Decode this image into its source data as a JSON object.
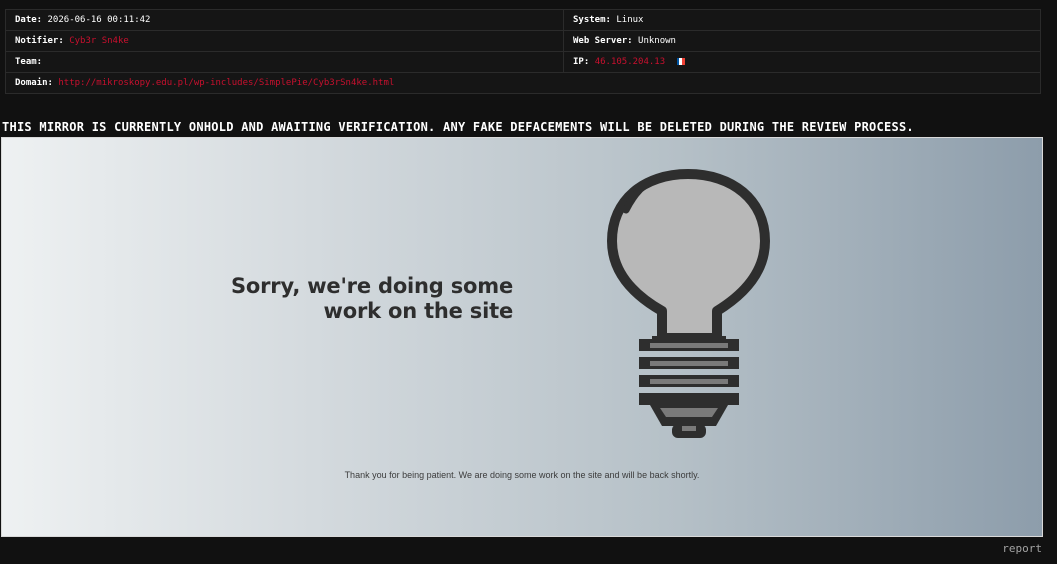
{
  "info": {
    "date_label": "Date:",
    "date_value": "2026-06-16 00:11:42",
    "system_label": "System:",
    "system_value": "Linux",
    "notifier_label": "Notifier:",
    "notifier_value": "Cyb3r Sn4ke",
    "webserver_label": "Web Server:",
    "webserver_value": "Unknown",
    "team_label": "Team:",
    "team_value": "",
    "ip_label": "IP:",
    "ip_value": "46.105.204.13",
    "domain_label": "Domain:",
    "domain_value": "http://mikroskopy.edu.pl/wp-includes/SimplePie/Cyb3rSn4ke.html",
    "flag_country": "France",
    "flag_colors": [
      "#0055a4",
      "#ffffff",
      "#ef4135"
    ]
  },
  "notice": "THIS MIRROR IS CURRENTLY ONHOLD AND AWAITING VERIFICATION. ANY FAKE DEFACEMENTS WILL BE DELETED DURING THE REVIEW PROCESS.",
  "mirror": {
    "headline_line1": "Sorry, we're doing some",
    "headline_line2": "work on the site",
    "subtext": "Thank you for being patient. We are doing some work on the site and will be back shortly.",
    "icon": "lightbulb-icon"
  },
  "footer": {
    "report_label": "report"
  },
  "colors": {
    "page_background": "#111111",
    "accent_red": "#c8102e",
    "bulb_fill": "#b8b8b8",
    "bulb_outline": "#2e2e2e"
  }
}
